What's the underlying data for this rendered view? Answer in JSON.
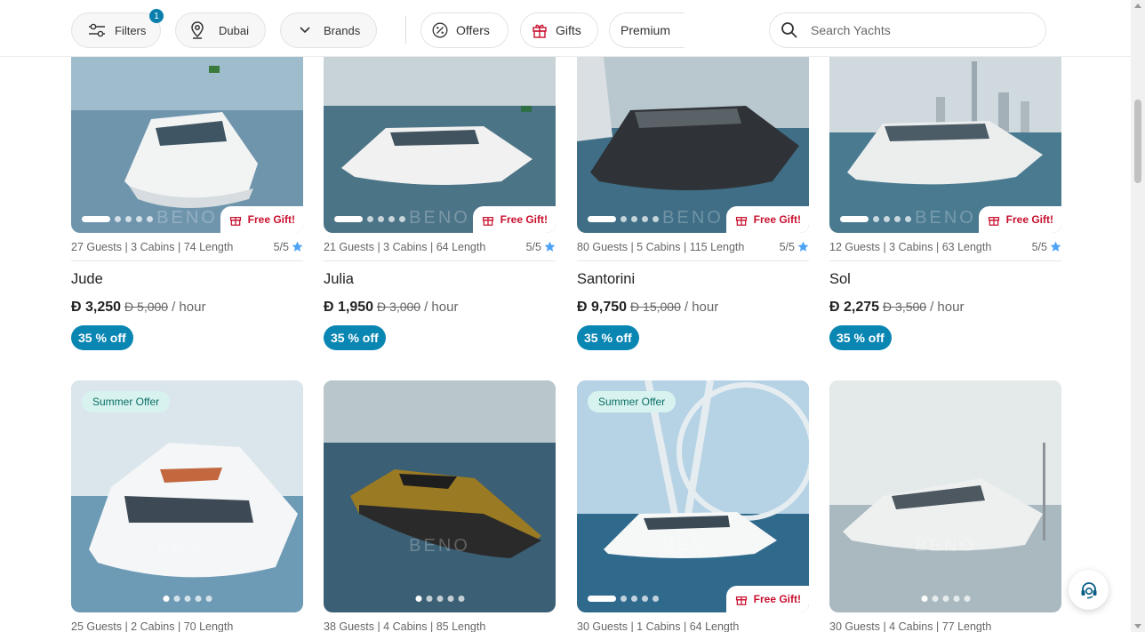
{
  "toolbar": {
    "filters_label": "Filters",
    "filters_count": "1",
    "location_label": "Dubai",
    "brands_label": "Brands",
    "offers_label": "Offers",
    "gifts_label": "Gifts",
    "premium_label": "Premium",
    "search_placeholder": "Search Yachts"
  },
  "icons": {
    "filters": "sliders-icon",
    "location": "map-pin-icon",
    "brands": "chevron-down-icon",
    "offers": "percent-icon",
    "gifts": "gift-icon",
    "search": "search-icon",
    "support": "headset-icon",
    "rating": "star-icon"
  },
  "colors": {
    "accent": "#0a86b3",
    "gift_red": "#c8102e",
    "offer_bg": "#d8f3ef",
    "star": "#4fa3f7"
  },
  "labels": {
    "free_gift": "Free Gift!",
    "summer_offer": "Summer Offer",
    "per_hour": "/ hour",
    "currency": "Ð"
  },
  "yachts": [
    {
      "meta": "27 Guests | 3 Cabins | 74 Length",
      "rating": "5/5",
      "name": "Jude",
      "price": "Ð 3,250",
      "old_price": "Ð 5,000",
      "discount": "35 % off"
    },
    {
      "meta": "21 Guests | 3 Cabins | 64 Length",
      "rating": "5/5",
      "name": "Julia",
      "price": "Ð 1,950",
      "old_price": "Ð 3,000",
      "discount": "35 % off"
    },
    {
      "meta": "80 Guests | 5 Cabins | 115 Length",
      "rating": "5/5",
      "name": "Santorini",
      "price": "Ð 9,750",
      "old_price": "Ð 15,000",
      "discount": "35 % off"
    },
    {
      "meta": "12 Guests | 3 Cabins | 63 Length",
      "rating": "5/5",
      "name": "Sol",
      "price": "Ð 2,275",
      "old_price": "Ð 3,500",
      "discount": "35 % off"
    },
    {
      "meta": "25 Guests | 2 Cabins | 70 Length"
    },
    {
      "meta": "38 Guests | 4 Cabins | 85 Length"
    },
    {
      "meta": "30 Guests | 1 Cabins | 64 Length"
    },
    {
      "meta": "30 Guests | 4 Cabins | 77 Length"
    }
  ]
}
